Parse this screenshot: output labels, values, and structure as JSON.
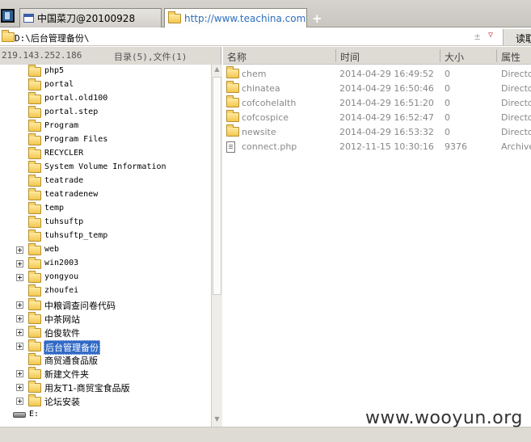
{
  "tabs": [
    {
      "label": "中国菜刀@20100928",
      "active": false
    },
    {
      "label": "http://www.teachina.com/up...",
      "active": true
    }
  ],
  "new_tab_label": "+",
  "path": {
    "value": "D:\\后台管理备份\\",
    "plusminus": "±",
    "read_button": "读取"
  },
  "info": {
    "ip": "219.143.252.186",
    "counts": "目录(5),文件(1)"
  },
  "tree": [
    {
      "name": "php5",
      "expander": false,
      "folder": true
    },
    {
      "name": "portal",
      "expander": false,
      "folder": true
    },
    {
      "name": "portal.old100",
      "expander": false,
      "folder": true
    },
    {
      "name": "portal.step",
      "expander": false,
      "folder": true
    },
    {
      "name": "Program",
      "expander": false,
      "folder": true
    },
    {
      "name": "Program Files",
      "expander": false,
      "folder": true
    },
    {
      "name": "RECYCLER",
      "expander": false,
      "folder": true
    },
    {
      "name": "System Volume Information",
      "expander": false,
      "folder": true
    },
    {
      "name": "teatrade",
      "expander": false,
      "folder": true
    },
    {
      "name": "teatradenew",
      "expander": false,
      "folder": true
    },
    {
      "name": "temp",
      "expander": false,
      "folder": true
    },
    {
      "name": "tuhsuftp",
      "expander": false,
      "folder": true
    },
    {
      "name": "tuhsuftp_temp",
      "expander": false,
      "folder": true
    },
    {
      "name": "web",
      "expander": true,
      "folder": true
    },
    {
      "name": "win2003",
      "expander": true,
      "folder": true
    },
    {
      "name": "yongyou",
      "expander": true,
      "folder": true
    },
    {
      "name": "zhoufei",
      "expander": false,
      "folder": true
    },
    {
      "name": "中粮调查问卷代码",
      "expander": true,
      "folder": true
    },
    {
      "name": "中茶网站",
      "expander": true,
      "folder": true
    },
    {
      "name": "伯俊软件",
      "expander": true,
      "folder": true
    },
    {
      "name": "后台管理备份",
      "expander": true,
      "folder": true,
      "selected": true
    },
    {
      "name": "商贸通食品版",
      "expander": false,
      "folder": true
    },
    {
      "name": "新建文件夹",
      "expander": true,
      "folder": true
    },
    {
      "name": "用友T1-商贸宝食品版",
      "expander": true,
      "folder": true
    },
    {
      "name": "论坛安装",
      "expander": true,
      "folder": true
    },
    {
      "name": "E:",
      "expander": false,
      "folder": false,
      "drive": true
    }
  ],
  "list": {
    "columns": [
      "名称",
      "时间",
      "大小",
      "属性"
    ],
    "rows": [
      {
        "type": "folder",
        "name": "chem",
        "time": "2014-04-29 16:49:52",
        "size": "0",
        "attr": "Directory"
      },
      {
        "type": "folder",
        "name": "chinatea",
        "time": "2014-04-29 16:50:46",
        "size": "0",
        "attr": "Directory"
      },
      {
        "type": "folder",
        "name": "cofcohelalth",
        "time": "2014-04-29 16:51:20",
        "size": "0",
        "attr": "Directory"
      },
      {
        "type": "folder",
        "name": "cofcospice",
        "time": "2014-04-29 16:52:47",
        "size": "0",
        "attr": "Directory"
      },
      {
        "type": "folder",
        "name": "newsite",
        "time": "2014-04-29 16:53:32",
        "size": "0",
        "attr": "Directory"
      },
      {
        "type": "file",
        "name": "connect.php",
        "time": "2012-11-15 10:30:16",
        "size": "9376",
        "attr": "Archive"
      }
    ]
  },
  "watermark": "www.wooyun.org"
}
